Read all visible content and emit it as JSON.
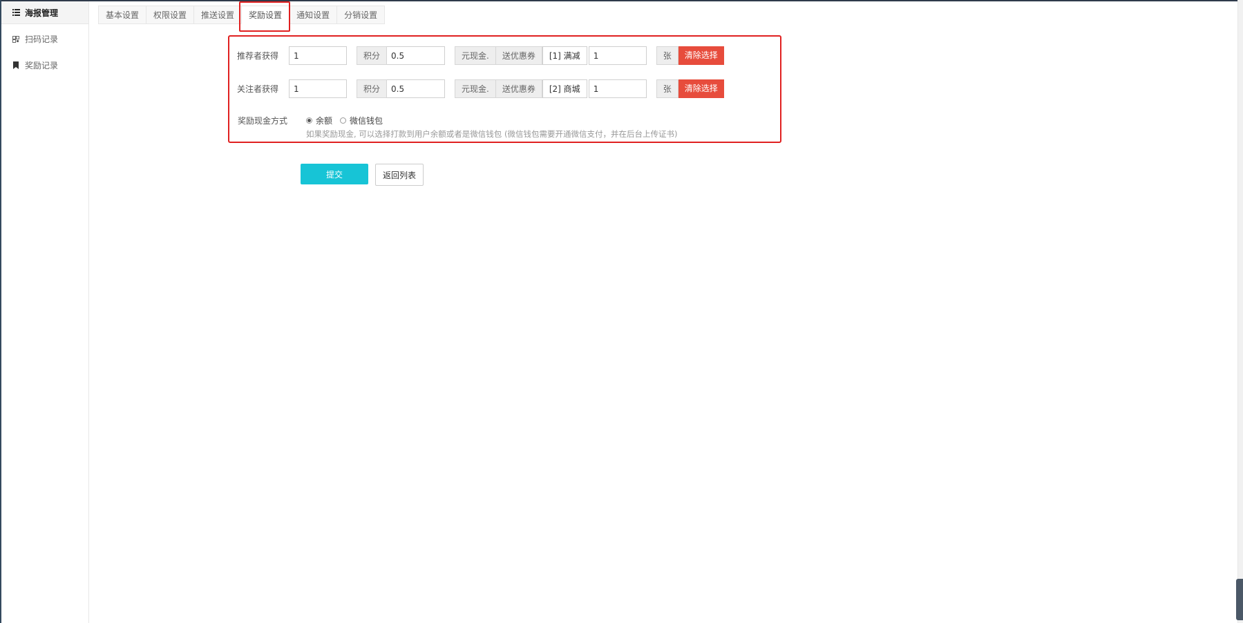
{
  "sidebar": {
    "items": [
      {
        "label": "海报管理",
        "icon": "list-icon",
        "active": true
      },
      {
        "label": "扫码记录",
        "icon": "qrcode-icon",
        "active": false
      },
      {
        "label": "奖励记录",
        "icon": "bookmark-icon",
        "active": false
      }
    ]
  },
  "tabs": [
    {
      "label": "基本设置"
    },
    {
      "label": "权限设置"
    },
    {
      "label": "推送设置"
    },
    {
      "label": "奖励设置",
      "active": true
    },
    {
      "label": "通知设置"
    },
    {
      "label": "分销设置"
    }
  ],
  "reward": {
    "referrer": {
      "label": "推荐者获得",
      "points_value": "1",
      "points_unit": "积分",
      "cash_value": "0.5",
      "cash_unit": "元现金.",
      "coupon_label": "送优惠券",
      "coupon_selected": "[1] 满减",
      "coupon_count": "1",
      "count_unit": "张",
      "clear_label": "清除选择"
    },
    "follower": {
      "label": "关注者获得",
      "points_value": "1",
      "points_unit": "积分",
      "cash_value": "0.5",
      "cash_unit": "元现金.",
      "coupon_label": "送优惠券",
      "coupon_selected": "[2] 商城",
      "coupon_count": "1",
      "count_unit": "张",
      "clear_label": "清除选择"
    },
    "cash_method": {
      "label": "奖励现金方式",
      "options": [
        {
          "label": "余额",
          "checked": true
        },
        {
          "label": "微信钱包",
          "checked": false
        }
      ],
      "help": "如果奖励现金, 可以选择打款到用户余额或者是微信钱包 (微信钱包需要开通微信支付，并在后台上传证书)"
    }
  },
  "actions": {
    "submit_label": "提交",
    "back_label": "返回列表"
  },
  "colors": {
    "accent": "#17c4d6",
    "danger": "#e74c3c",
    "highlight": "#e02020"
  }
}
